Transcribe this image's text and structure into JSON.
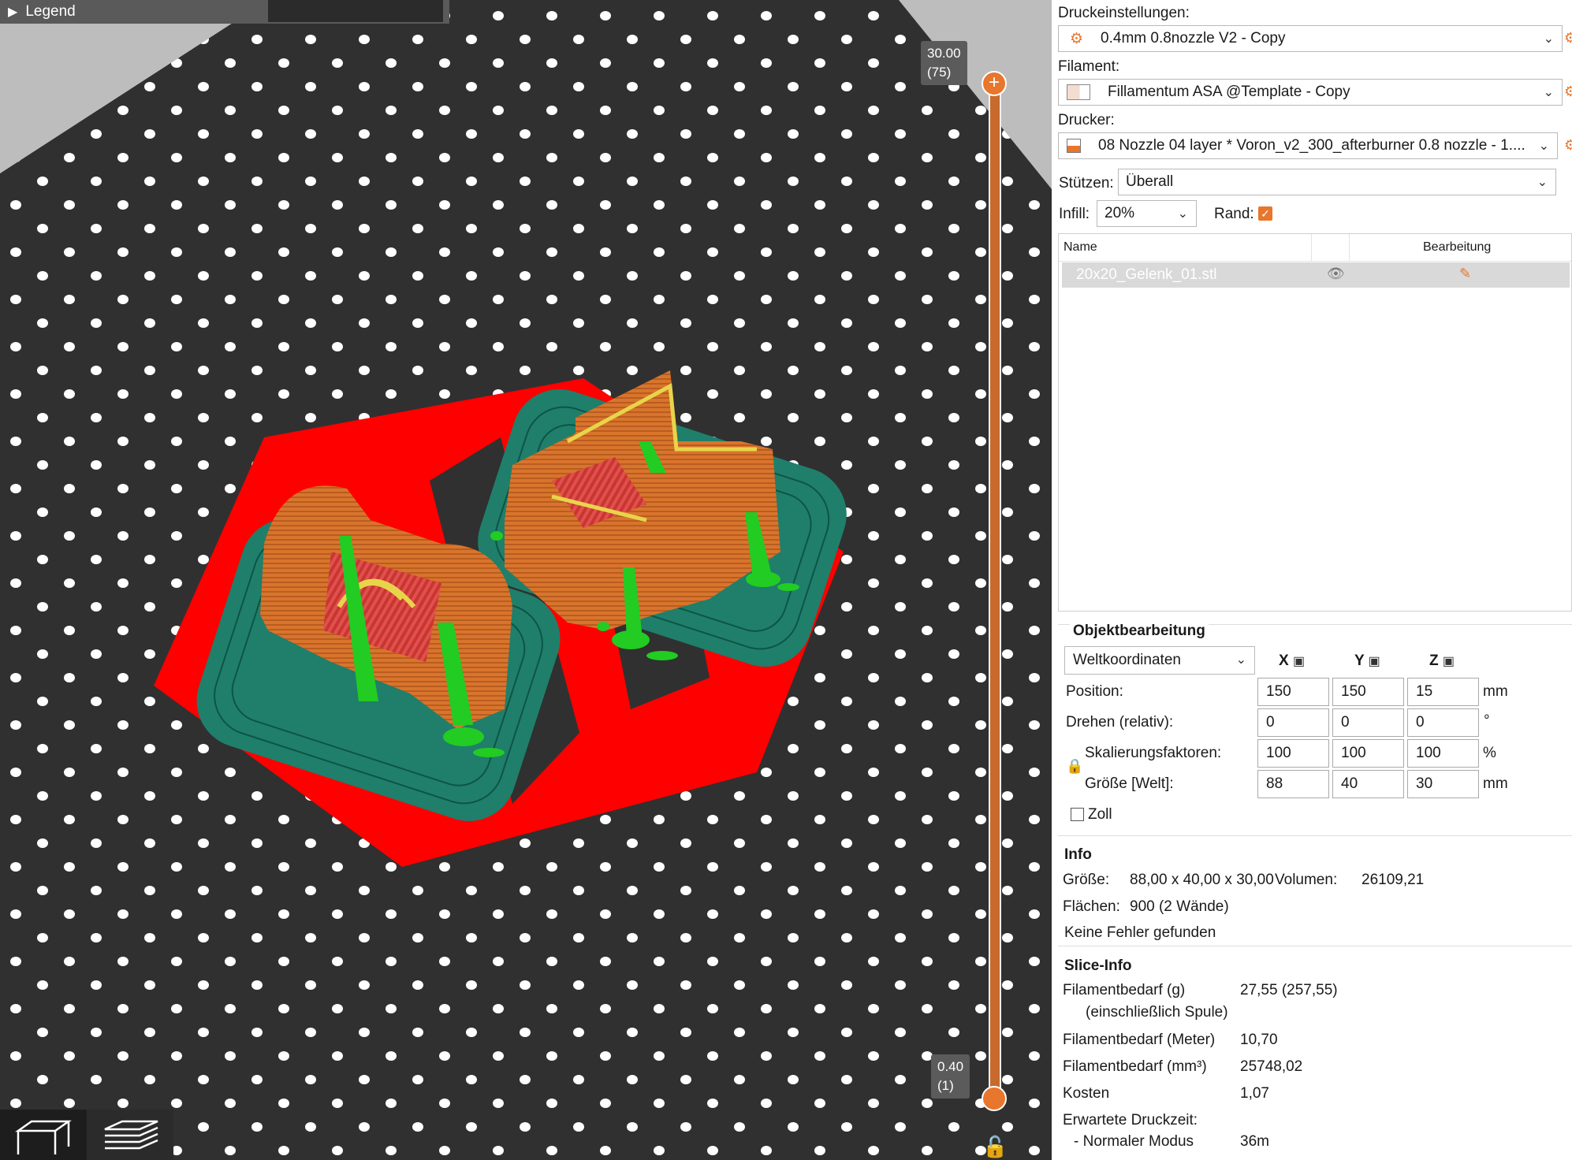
{
  "viewport": {
    "legend_label": "Legend",
    "layer_top": {
      "height": "30.00",
      "layer": "(75)"
    },
    "layer_bottom": {
      "height": "0.40",
      "layer": "(1)"
    }
  },
  "settings": {
    "print_label": "Druckeinstellungen:",
    "print_value": "0.4mm 0.8nozzle V2 - Copy",
    "filament_label": "Filament:",
    "filament_value": "Fillamentum ASA @Template - Copy",
    "printer_label": "Drucker:",
    "printer_value": "08 Nozzle 04 layer * Voron_v2_300_afterburner 0.8 nozzle - 1....",
    "supports_label": "Stützen:",
    "supports_value": "Überall",
    "infill_label": "Infill:",
    "infill_value": "20%",
    "brim_label": "Rand:"
  },
  "object_list": {
    "col_name": "Name",
    "col_edit": "Bearbeitung",
    "rows": [
      {
        "name": "20x20_Gelenk_01.stl"
      }
    ]
  },
  "object_manipulation": {
    "title": "Objektbearbeitung",
    "coord_system": "Weltkoordinaten",
    "axes": [
      "X",
      "Y",
      "Z"
    ],
    "position_label": "Position:",
    "position": [
      "150",
      "150",
      "15"
    ],
    "position_unit": "mm",
    "rotate_label": "Drehen (relativ):",
    "rotate": [
      "0",
      "0",
      "0"
    ],
    "rotate_unit": "°",
    "scale_label": "Skalierungsfaktoren:",
    "scale": [
      "100",
      "100",
      "100"
    ],
    "scale_unit": "%",
    "size_label": "Größe [Welt]:",
    "size": [
      "88",
      "40",
      "30"
    ],
    "size_unit": "mm",
    "inch_label": "Zoll"
  },
  "info": {
    "title": "Info",
    "size_label": "Größe:",
    "size_value": "88,00 x 40,00 x 30,00",
    "volume_label": "Volumen:",
    "volume_value": "26109,21",
    "facets_label": "Flächen:",
    "facets_value": "900 (2 Wände)",
    "errors": "Keine Fehler gefunden"
  },
  "slice_info": {
    "title": "Slice-Info",
    "filament_g_label": "Filamentbedarf (g)",
    "filament_g_sub": "(einschließlich Spule)",
    "filament_g_value": "27,55 (257,55)",
    "filament_m_label": "Filamentbedarf (Meter)",
    "filament_m_value": "10,70",
    "filament_mm3_label": "Filamentbedarf (mm³)",
    "filament_mm3_value": "25748,02",
    "cost_label": "Kosten",
    "cost_value": "1,07",
    "time_label": "Erwartete Druckzeit:",
    "mode_label": "- Normaler Modus",
    "mode_value": "36m"
  },
  "colors": {
    "accent": "#e8762d",
    "bed": "#333333",
    "skirt": "#ff0000",
    "brim": "#1f7f6a",
    "perimeter": "#e07b2d",
    "top_solid": "#e8d44a",
    "support": "#22cc22"
  }
}
